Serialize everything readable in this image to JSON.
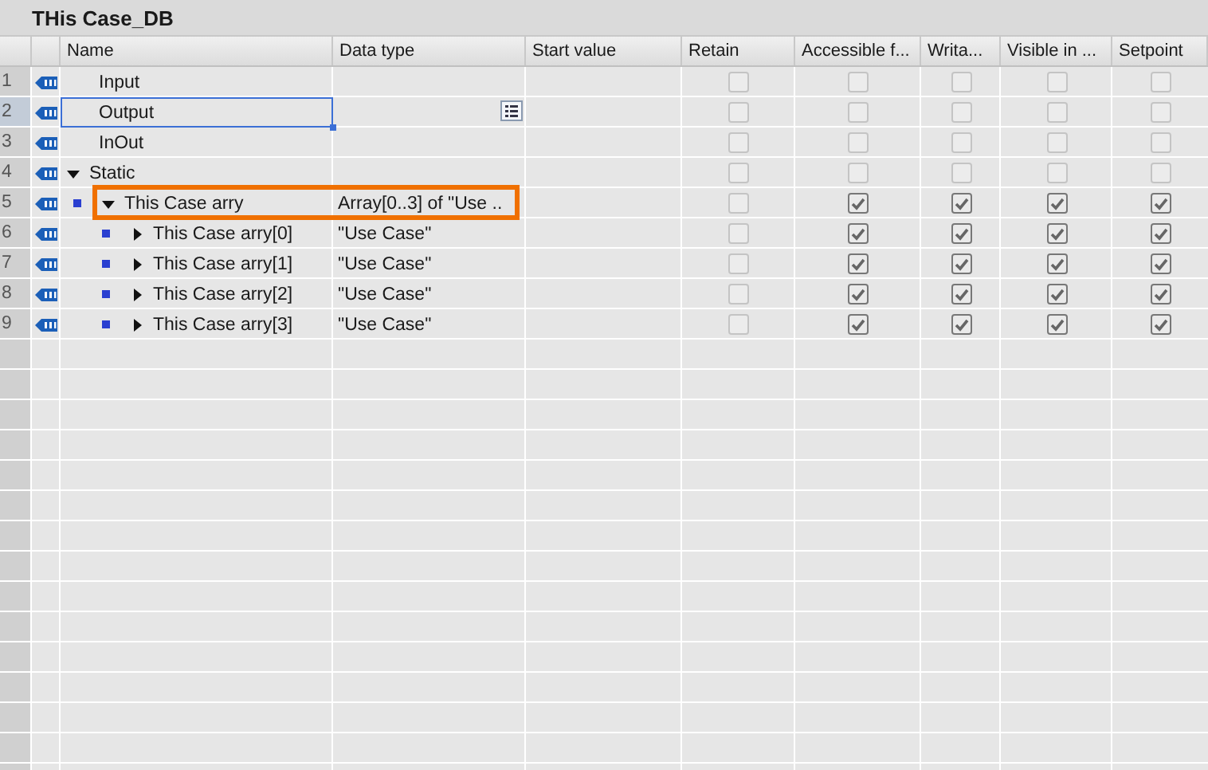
{
  "title": "THis Case_DB",
  "columns": [
    "Name",
    "Data type",
    "Start value",
    "Retain",
    "Accessible f...",
    "Writa...",
    "Visible in ...",
    "Setpoint"
  ],
  "rows": [
    {
      "number": "1",
      "name": "Input",
      "data_type": "",
      "selected": false,
      "highlighted": false,
      "flags": [
        {
          "checked": false,
          "disabled": true
        },
        {
          "checked": false,
          "disabled": true
        },
        {
          "checked": false,
          "disabled": true
        },
        {
          "checked": false,
          "disabled": true
        },
        {
          "checked": false,
          "disabled": true
        }
      ]
    },
    {
      "number": "2",
      "name": "Output",
      "data_type": "",
      "selected": true,
      "highlighted": false,
      "flags": [
        {
          "checked": false,
          "disabled": true
        },
        {
          "checked": false,
          "disabled": true
        },
        {
          "checked": false,
          "disabled": true
        },
        {
          "checked": false,
          "disabled": true
        },
        {
          "checked": false,
          "disabled": true
        }
      ]
    },
    {
      "number": "3",
      "name": "InOut",
      "data_type": "",
      "selected": false,
      "highlighted": false,
      "flags": [
        {
          "checked": false,
          "disabled": true
        },
        {
          "checked": false,
          "disabled": true
        },
        {
          "checked": false,
          "disabled": true
        },
        {
          "checked": false,
          "disabled": true
        },
        {
          "checked": false,
          "disabled": true
        }
      ]
    },
    {
      "number": "4",
      "name": "Static",
      "data_type": "",
      "selected": false,
      "highlighted": false,
      "expanded": true,
      "flags": [
        {
          "checked": false,
          "disabled": true
        },
        {
          "checked": false,
          "disabled": true
        },
        {
          "checked": false,
          "disabled": true
        },
        {
          "checked": false,
          "disabled": true
        },
        {
          "checked": false,
          "disabled": true
        }
      ],
      "children": [
        {
          "number": "5",
          "name": "This Case arry",
          "data_type": "Array[0..3] of \"Use ..",
          "selected": false,
          "highlighted": true,
          "expanded": true,
          "flags": [
            {
              "checked": false,
              "disabled": true
            },
            {
              "checked": true,
              "disabled": false
            },
            {
              "checked": true,
              "disabled": false
            },
            {
              "checked": true,
              "disabled": false
            },
            {
              "checked": true,
              "disabled": false
            }
          ],
          "children": [
            {
              "number": "6",
              "name": "This Case arry[0]",
              "data_type": "\"Use Case\"",
              "selected": false,
              "highlighted": false,
              "expanded": false,
              "flags": [
                {
                  "checked": false,
                  "disabled": true
                },
                {
                  "checked": true,
                  "disabled": false
                },
                {
                  "checked": true,
                  "disabled": false
                },
                {
                  "checked": true,
                  "disabled": false
                },
                {
                  "checked": true,
                  "disabled": false
                }
              ]
            },
            {
              "number": "7",
              "name": "This Case arry[1]",
              "data_type": "\"Use Case\"",
              "selected": false,
              "highlighted": false,
              "expanded": false,
              "flags": [
                {
                  "checked": false,
                  "disabled": true
                },
                {
                  "checked": true,
                  "disabled": false
                },
                {
                  "checked": true,
                  "disabled": false
                },
                {
                  "checked": true,
                  "disabled": false
                },
                {
                  "checked": true,
                  "disabled": false
                }
              ]
            },
            {
              "number": "8",
              "name": "This Case arry[2]",
              "data_type": "\"Use Case\"",
              "selected": false,
              "highlighted": false,
              "expanded": false,
              "flags": [
                {
                  "checked": false,
                  "disabled": true
                },
                {
                  "checked": true,
                  "disabled": false
                },
                {
                  "checked": true,
                  "disabled": false
                },
                {
                  "checked": true,
                  "disabled": false
                },
                {
                  "checked": true,
                  "disabled": false
                }
              ]
            },
            {
              "number": "9",
              "name": "This Case arry[3]",
              "data_type": "\"Use Case\"",
              "selected": false,
              "highlighted": false,
              "expanded": false,
              "flags": [
                {
                  "checked": false,
                  "disabled": true
                },
                {
                  "checked": true,
                  "disabled": false
                },
                {
                  "checked": true,
                  "disabled": false
                },
                {
                  "checked": true,
                  "disabled": false
                },
                {
                  "checked": true,
                  "disabled": false
                }
              ]
            }
          ]
        }
      ]
    }
  ]
}
